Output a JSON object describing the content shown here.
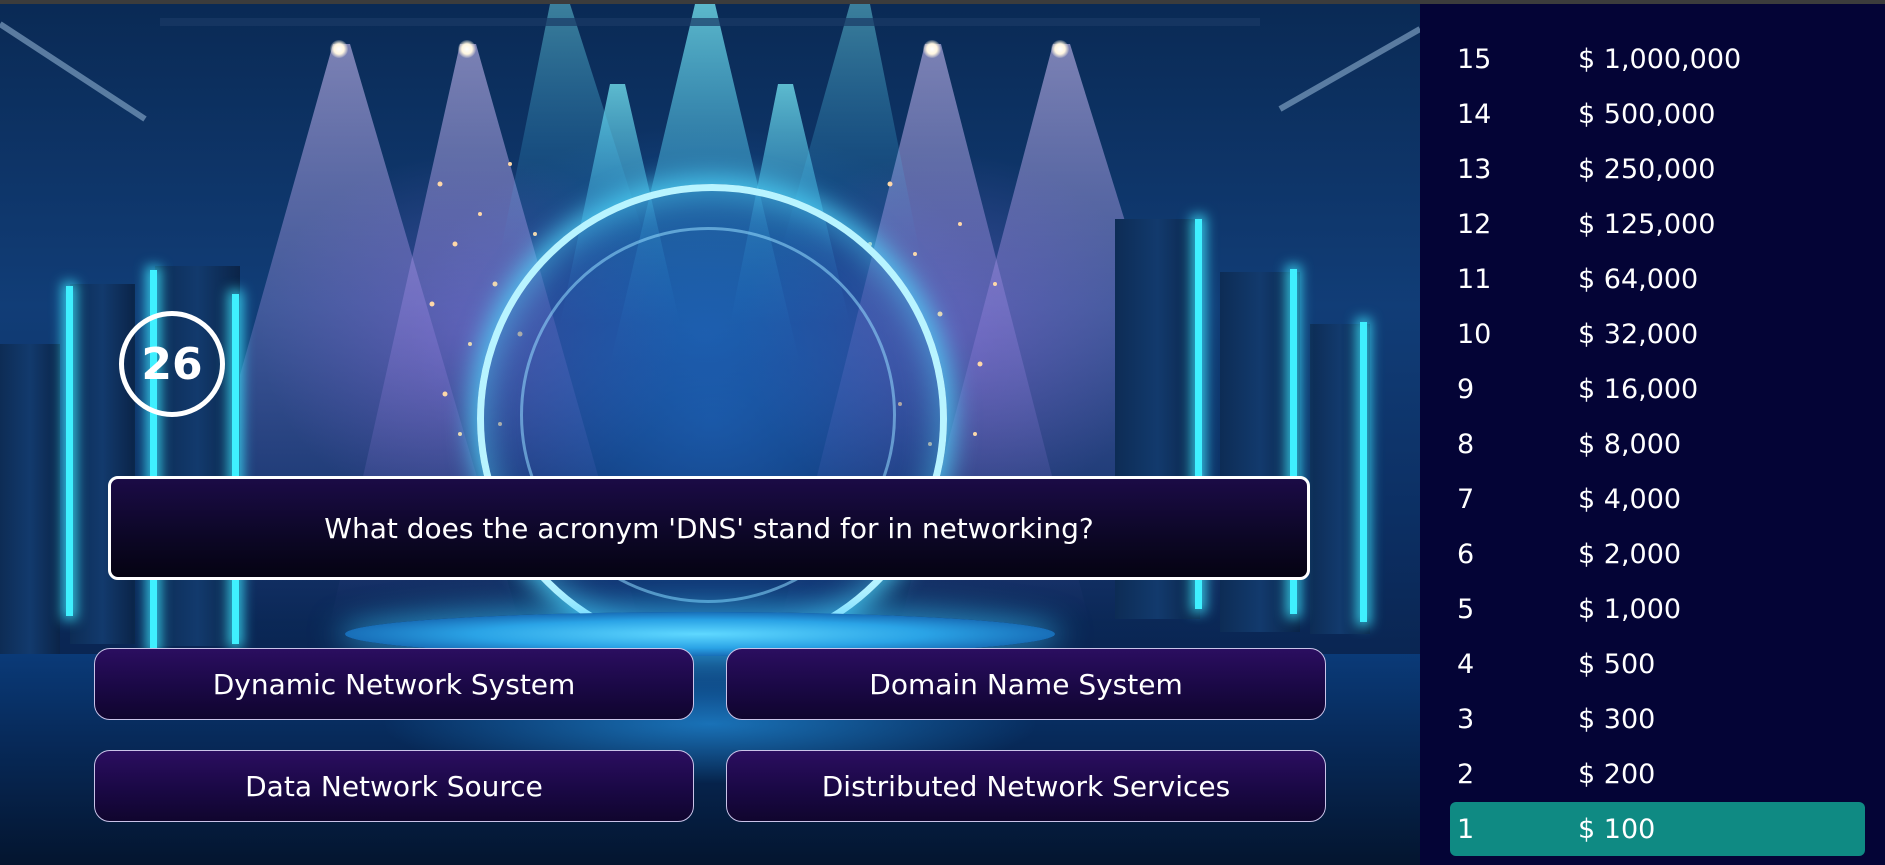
{
  "timer": {
    "value": "26"
  },
  "question": {
    "text": "What does the acronym 'DNS' stand for in networking?"
  },
  "answers": [
    {
      "label": "Dynamic Network System"
    },
    {
      "label": "Domain Name System"
    },
    {
      "label": "Data Network Source"
    },
    {
      "label": "Distributed Network Services"
    }
  ],
  "ladder": {
    "current_level": "1",
    "current_color": "#0f8a83",
    "rows": [
      {
        "level": "15",
        "amount": "$ 1,000,000"
      },
      {
        "level": "14",
        "amount": "$ 500,000"
      },
      {
        "level": "13",
        "amount": "$ 250,000"
      },
      {
        "level": "12",
        "amount": "$ 125,000"
      },
      {
        "level": "11",
        "amount": "$ 64,000"
      },
      {
        "level": "10",
        "amount": "$ 32,000"
      },
      {
        "level": "9",
        "amount": "$ 16,000"
      },
      {
        "level": "8",
        "amount": "$ 8,000"
      },
      {
        "level": "7",
        "amount": "$ 4,000"
      },
      {
        "level": "6",
        "amount": "$ 2,000"
      },
      {
        "level": "5",
        "amount": "$ 1,000"
      },
      {
        "level": "4",
        "amount": "$ 500"
      },
      {
        "level": "3",
        "amount": "$ 300"
      },
      {
        "level": "2",
        "amount": "$ 200"
      },
      {
        "level": "1",
        "amount": "$ 100"
      }
    ]
  }
}
